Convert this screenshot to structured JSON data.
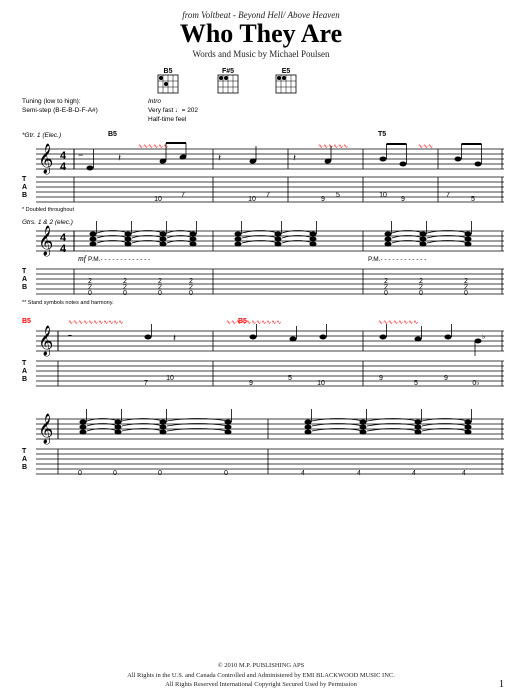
{
  "header": {
    "from_line": "from Voltbeat - Beyond Hell/ Above Heaven",
    "title": "Who They Are",
    "composer": "Words and Music by Michael Poulsen"
  },
  "chords": [
    {
      "name": "B5",
      "position": ""
    },
    {
      "name": "F#5",
      "position": ""
    },
    {
      "name": "E5",
      "position": ""
    }
  ],
  "tuning": {
    "label": "Tuning (low to high):",
    "value": "Semi-step (B-E-B-D-F-A#)"
  },
  "tempo": {
    "intro_label": "Intro",
    "bpm": "♩= 202",
    "feel": "Half-time feel"
  },
  "footer": {
    "copyright": "© 2010 M.P. PUBLISHING APS",
    "rights": "All Rights in the U.S. and Canada Controlled and Administered by EMI BLACKWOOD MUSIC INC.",
    "reserved": "All Rights Reserved   International Copyright Secured   Used by Permission"
  },
  "page_number": "1"
}
